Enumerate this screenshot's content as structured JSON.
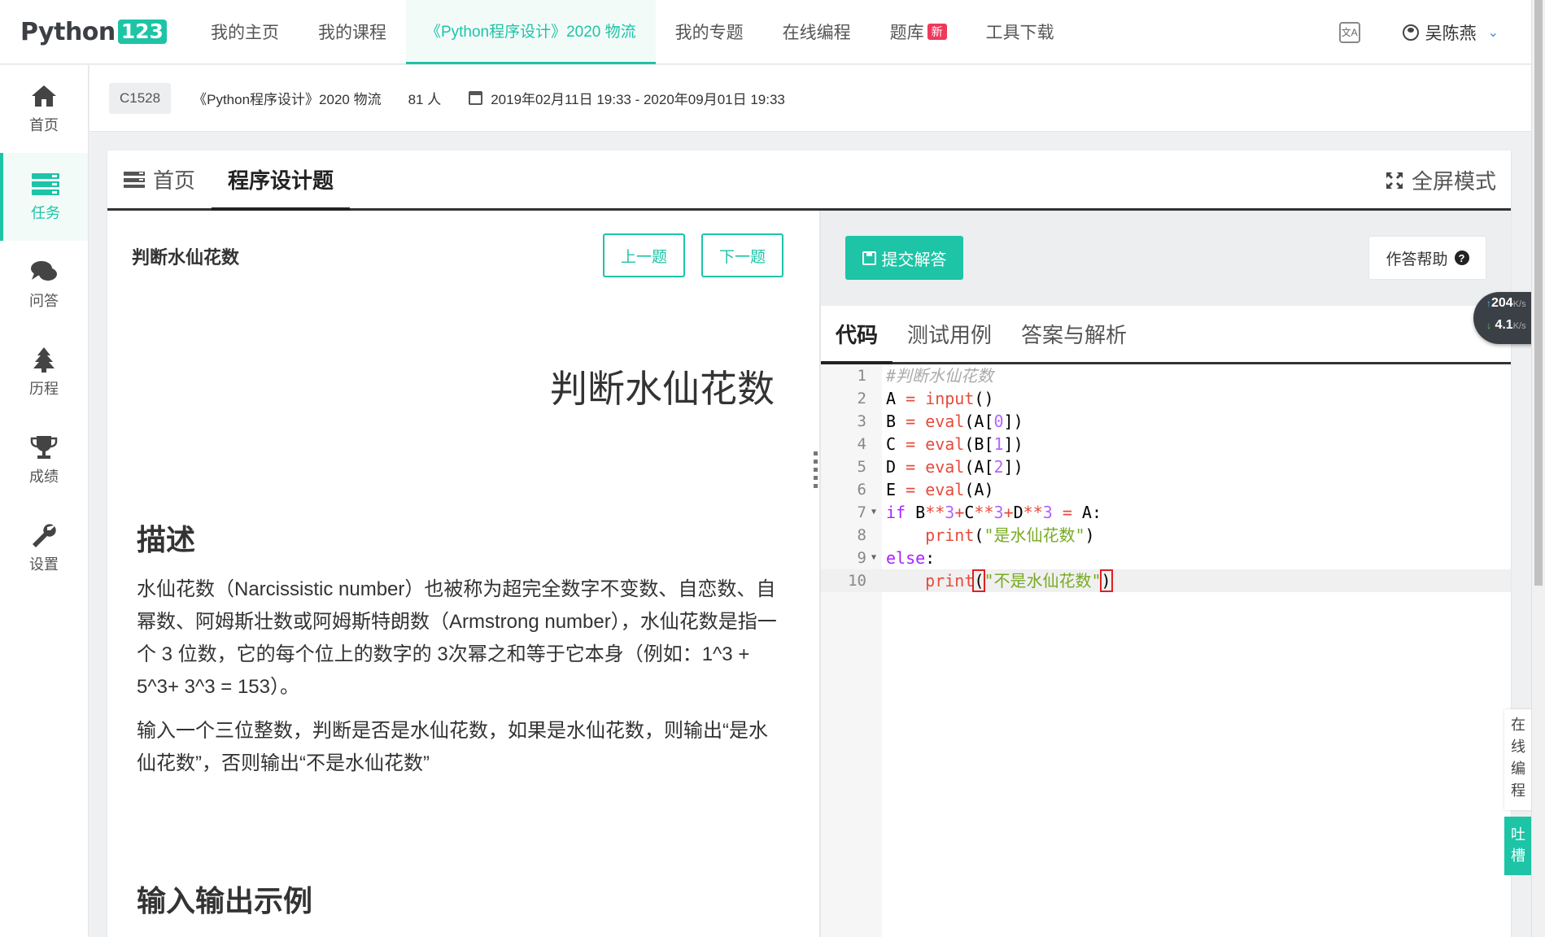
{
  "logo": {
    "text": "Python",
    "badge": "123"
  },
  "nav": {
    "items": [
      {
        "label": "我的主页"
      },
      {
        "label": "我的课程"
      },
      {
        "label": "《Python程序设计》2020 物流"
      },
      {
        "label": "我的专题"
      },
      {
        "label": "在线编程"
      },
      {
        "label": "题库",
        "badge": "新"
      },
      {
        "label": "工具下载"
      }
    ],
    "active_index": 2,
    "user_name": "吴陈燕"
  },
  "sidebar": {
    "items": [
      {
        "label": "首页",
        "icon": "home-icon"
      },
      {
        "label": "任务",
        "icon": "tasks-icon"
      },
      {
        "label": "问答",
        "icon": "comments-icon"
      },
      {
        "label": "历程",
        "icon": "tree-icon"
      },
      {
        "label": "成绩",
        "icon": "trophy-icon"
      },
      {
        "label": "设置",
        "icon": "wrench-icon"
      }
    ],
    "active_index": 1
  },
  "course": {
    "code": "C1528",
    "name": "《Python程序设计》2020 物流",
    "count": "81 人",
    "date_range": "2019年02月11日 19:33 - 2020年09月01日 19:33"
  },
  "card": {
    "tab_home": "首页",
    "tab_program": "程序设计题",
    "fullscreen": "全屏模式"
  },
  "problem": {
    "title": "判断水仙花数",
    "prev": "上一题",
    "next": "下一题",
    "big_title": "判断水仙花数",
    "desc_heading": "描述",
    "desc_p1": "水仙花数（Narcissistic number）也被称为超完全数字不变数、自恋数、自幂数、阿姆斯壮数或阿姆斯特朗数（Armstrong number），水仙花数是指一个 3 位数，它的每个位上的数字的 3次幂之和等于它本身（例如：1^3 + 5^3+ 3^3 = 153）。",
    "desc_p2": "输入一个三位整数，判断是否是水仙花数，如果是水仙花数，则输出“是水仙花数”，否则输出“不是水仙花数”",
    "io_heading": "输入输出示例"
  },
  "editor": {
    "submit": "提交解答",
    "help": "作答帮助",
    "tabs": [
      "代码",
      "测试用例",
      "答案与解析"
    ],
    "line_numbers": [
      "1",
      "2",
      "3",
      "4",
      "5",
      "6",
      "7",
      "8",
      "9",
      "10"
    ]
  },
  "speed": {
    "up": "204",
    "up_unit": "K/s",
    "down": "4.1",
    "down_unit": "K/s"
  },
  "float": {
    "online": "在线编程",
    "tucao": "吐槽"
  },
  "colors": {
    "accent": "#1dc4a6",
    "badge_red": "#f0385b"
  }
}
